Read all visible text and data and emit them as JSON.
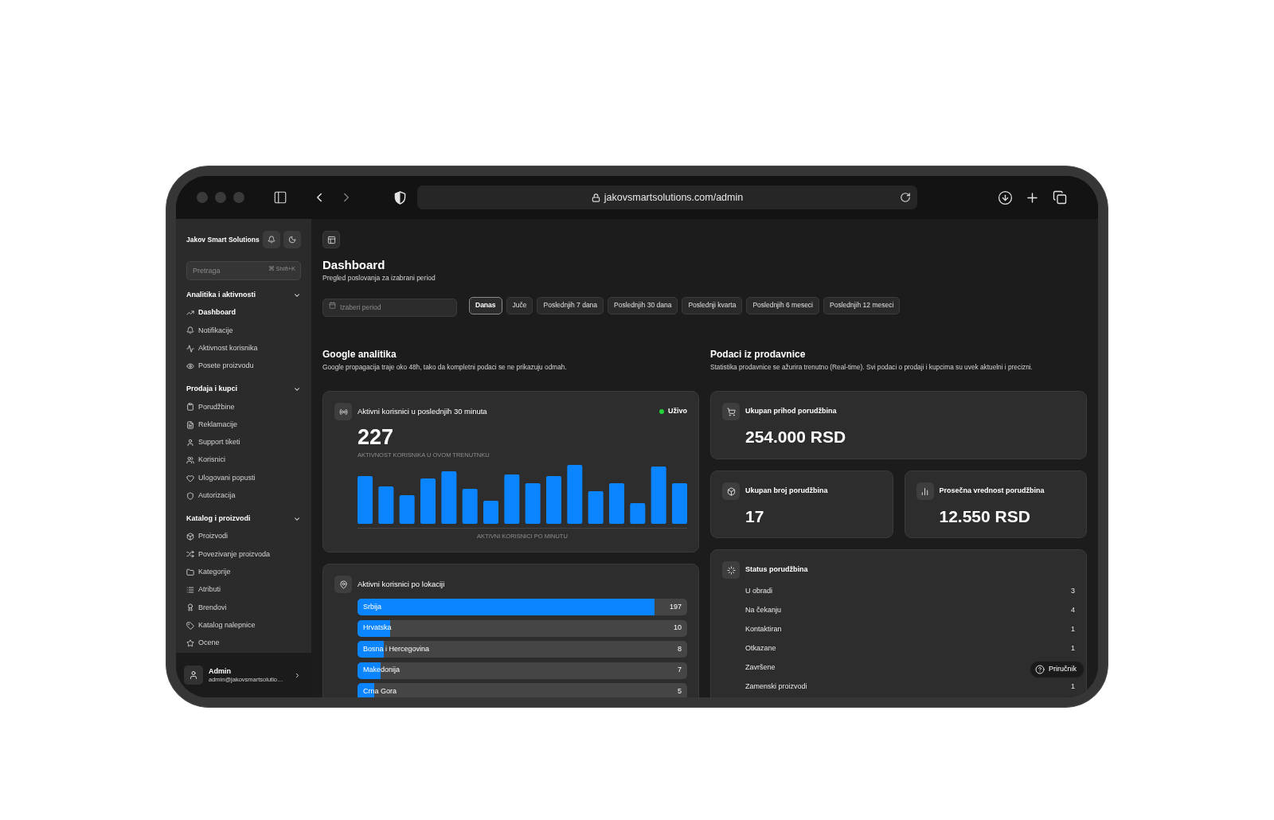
{
  "browser": {
    "url": "jakovsmartsolutions.com/admin"
  },
  "sidebar": {
    "brand": "Jakov Smart Solutions",
    "search": {
      "placeholder": "Pretraga",
      "shortcut": "⌘ Shift+K"
    },
    "sections": [
      {
        "title": "Analitika i aktivnosti",
        "expanded": true,
        "items": [
          {
            "label": "Dashboard",
            "selected": true
          },
          {
            "label": "Notifikacije",
            "selected": false
          },
          {
            "label": "Aktivnost korisnika",
            "selected": false
          },
          {
            "label": "Posete proizvodu",
            "selected": false
          }
        ]
      },
      {
        "title": "Prodaja i kupci",
        "expanded": true,
        "items": [
          {
            "label": "Porudžbine",
            "selected": false
          },
          {
            "label": "Reklamacije",
            "selected": false
          },
          {
            "label": "Support tiketi",
            "selected": false
          },
          {
            "label": "Korisnici",
            "selected": false
          },
          {
            "label": "Ulogovani popusti",
            "selected": false
          },
          {
            "label": "Autorizacija",
            "selected": false
          }
        ]
      },
      {
        "title": "Katalog i proizvodi",
        "expanded": true,
        "items": [
          {
            "label": "Proizvodi",
            "selected": false
          },
          {
            "label": "Povezivanje proizvoda",
            "selected": false
          },
          {
            "label": "Kategorije",
            "selected": false
          },
          {
            "label": "Atributi",
            "selected": false
          },
          {
            "label": "Brendovi",
            "selected": false
          },
          {
            "label": "Katalog nalepnice",
            "selected": false
          },
          {
            "label": "Ocene",
            "selected": false
          }
        ]
      }
    ],
    "user": {
      "name": "Admin",
      "email": "admin@jakovsmartsolutio…"
    }
  },
  "header": {
    "title": "Dashboard",
    "subtitle": "Pregled poslovanja za izabrani period"
  },
  "period": {
    "placeholder": "Izaberi period",
    "presets": [
      {
        "label": "Danas",
        "selected": true
      },
      {
        "label": "Juče",
        "selected": false
      },
      {
        "label": "Poslednjih 7 dana",
        "selected": false
      },
      {
        "label": "Poslednjih 30 dana",
        "selected": false
      },
      {
        "label": "Poslednji kvarta",
        "selected": false
      },
      {
        "label": "Poslednjih 6 meseci",
        "selected": false
      },
      {
        "label": "Poslednjih 12 meseci",
        "selected": false
      }
    ]
  },
  "google_analytics": {
    "title": "Google analitika",
    "description": "Google propagacija traje oko 48h, tako da kompletni podaci se ne prikazuju odmah.",
    "live_users": {
      "title": "Aktivni korisnici u poslednjih 30 minuta",
      "live_label": "Uživo",
      "count": "227",
      "caption": "AKTIVNOST KORISNIKA U OVOM TRENUTNKU",
      "chart_caption": "AKTIVNI KORISNICI PO MINUTU"
    },
    "locations": {
      "title": "Aktivni korisnici po lokaciji",
      "items": [
        {
          "name": "Srbija",
          "value": "197",
          "level": 0.9
        },
        {
          "name": "Hrvatska",
          "value": "10",
          "level": 0.1
        },
        {
          "name": "Bosna i Hercegovina",
          "value": "8",
          "level": 0.08
        },
        {
          "name": "Makedonija",
          "value": "7",
          "level": 0.07
        },
        {
          "name": "Crna Gora",
          "value": "5",
          "level": 0.05
        }
      ]
    }
  },
  "store_data": {
    "title": "Podaci iz prodavnice",
    "description": "Statistika prodavnice se ažurira trenutno (Real-time). Svi podaci o prodaji i kupcima su uvek aktuelni i precizni.",
    "stats": [
      {
        "label": "Ukupan prihod porudžbina",
        "value": "254.000 RSD"
      },
      {
        "label": "Ukupan broj porudžbina",
        "value": "17"
      },
      {
        "label": "Prosečna vrednost porudžbina",
        "value": "12.550 RSD"
      }
    ],
    "order_status": {
      "title": "Status porudžbina",
      "rows": [
        {
          "label": "U obradi",
          "value": "3"
        },
        {
          "label": "Na čekanju",
          "value": "4"
        },
        {
          "label": "Kontaktiran",
          "value": "1"
        },
        {
          "label": "Otkazane",
          "value": "1"
        },
        {
          "label": "Završene"
        },
        {
          "label": "Zamenski proizvodi",
          "value": "1"
        }
      ]
    }
  },
  "help_button": {
    "label": "Priručnik"
  }
}
